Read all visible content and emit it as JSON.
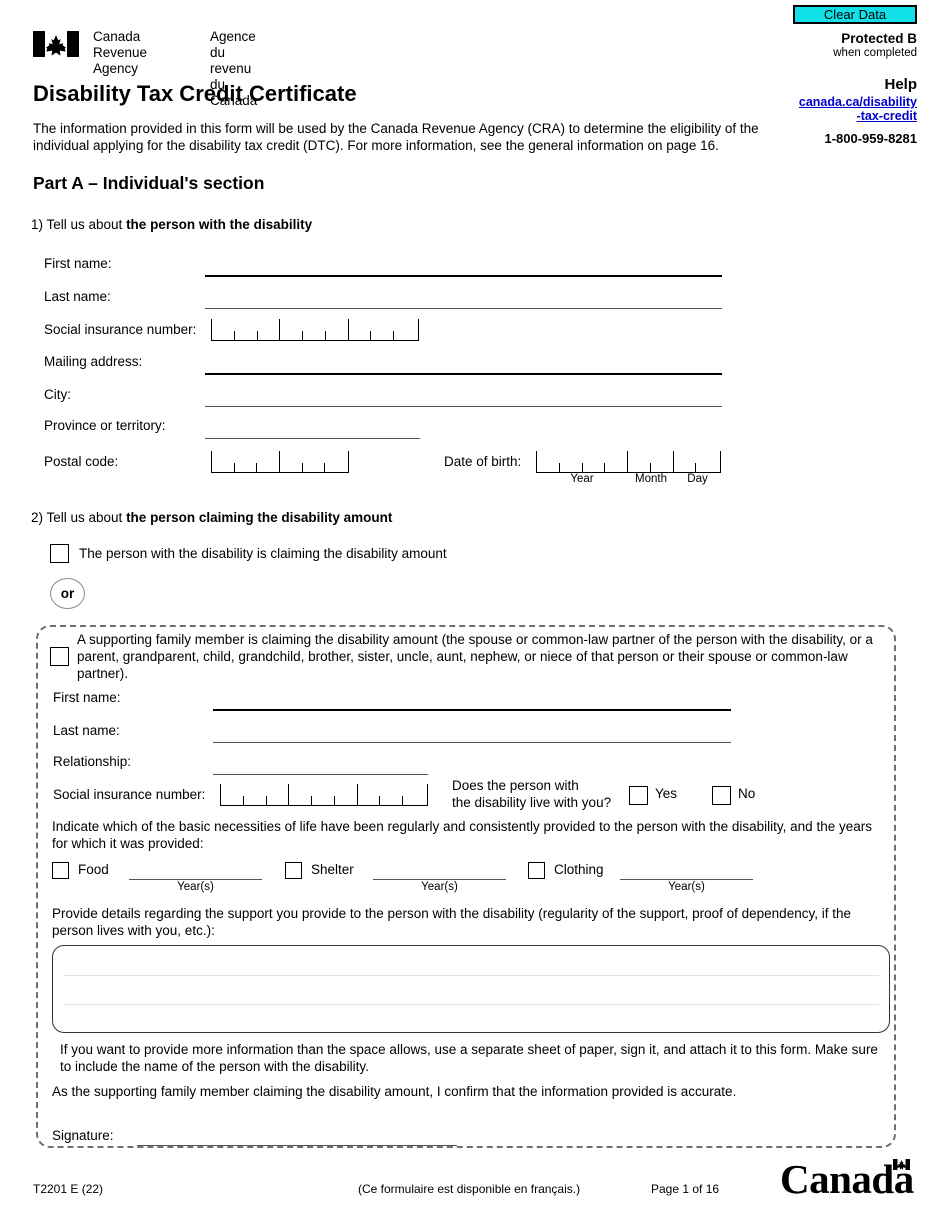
{
  "header": {
    "clear_data_label": "Clear Data",
    "protected_b": "Protected B",
    "when_completed": "when completed",
    "help_title": "Help",
    "help_link_line1": "canada.ca/disability",
    "help_link_line2": "-tax-credit",
    "help_phone": "1-800-959-8281",
    "cra_en": "Canada Revenue\nAgency",
    "cra_fr": "Agence du revenu\ndu Canada",
    "form_title": "Disability Tax Credit Certificate",
    "intro": "The information provided in this form will be used by the Canada Revenue Agency (CRA) to determine the eligibility of the individual applying for the disability tax credit (DTC). For more information, see the general information on page 16."
  },
  "part_a": {
    "title": "Part A – Individual's section",
    "q1_prefix": "1) Tell us about ",
    "q1_bold": "the person with the disability",
    "q2_prefix": "2) Tell us about ",
    "q2_bold": "the person claiming the disability amount",
    "fields": {
      "first_name": "First name:",
      "last_name": "Last name:",
      "sin": "Social insurance number:",
      "mailing_address": "Mailing address:",
      "city": "City:",
      "province": "Province or territory:",
      "postal_code": "Postal code:",
      "date_of_birth": "Date of birth:"
    },
    "dob_sub": {
      "year": "Year",
      "month": "Month",
      "day": "Day"
    },
    "claim_self_label": "The person with the disability is claiming the disability amount",
    "or_label": "or"
  },
  "supporting": {
    "intro": "A supporting family member is claiming the disability amount (the spouse or common-law partner of the person with the disability, or a parent, grandparent, child, grandchild, brother, sister, uncle, aunt, nephew, or niece of that person or their spouse or common-law partner).",
    "first_name": "First name:",
    "last_name": "Last name:",
    "relationship": "Relationship:",
    "sin": "Social insurance number:",
    "live_with_you_line1": "Does the person with",
    "live_with_you_line2": "the disability live with you?",
    "yes": "Yes",
    "no": "No",
    "necessities_intro": "Indicate which of the basic necessities of life have been regularly and consistently provided to the person with the disability, and the years for which it was provided:",
    "necessities": [
      {
        "label": "Food",
        "years_label": "Year(s)"
      },
      {
        "label": "Shelter",
        "years_label": "Year(s)"
      },
      {
        "label": "Clothing",
        "years_label": "Year(s)"
      }
    ],
    "details_prompt": "Provide details regarding the support you provide to the person with the disability (regularity of the support, proof of dependency, if the person lives with you, etc.):",
    "details_value": "",
    "more_info_note": "If you want to provide more information than the space allows, use a separate sheet of paper, sign it, and attach it to this form. Make sure to include the name of the person with the disability.",
    "confirm_note": "As the supporting family member claiming the disability amount, I confirm that the information provided is accurate.",
    "signature": "Signature:"
  },
  "footer": {
    "form_code": "T2201 E (22)",
    "french_note": "(Ce formulaire est disponible en français.)",
    "page": "Page 1 of 16",
    "wordmark": "Canada"
  },
  "colors": {
    "clear_button_bg": "#11e0e8",
    "link_blue": "#0000cc",
    "dashed_border": "#6e6e6e"
  }
}
